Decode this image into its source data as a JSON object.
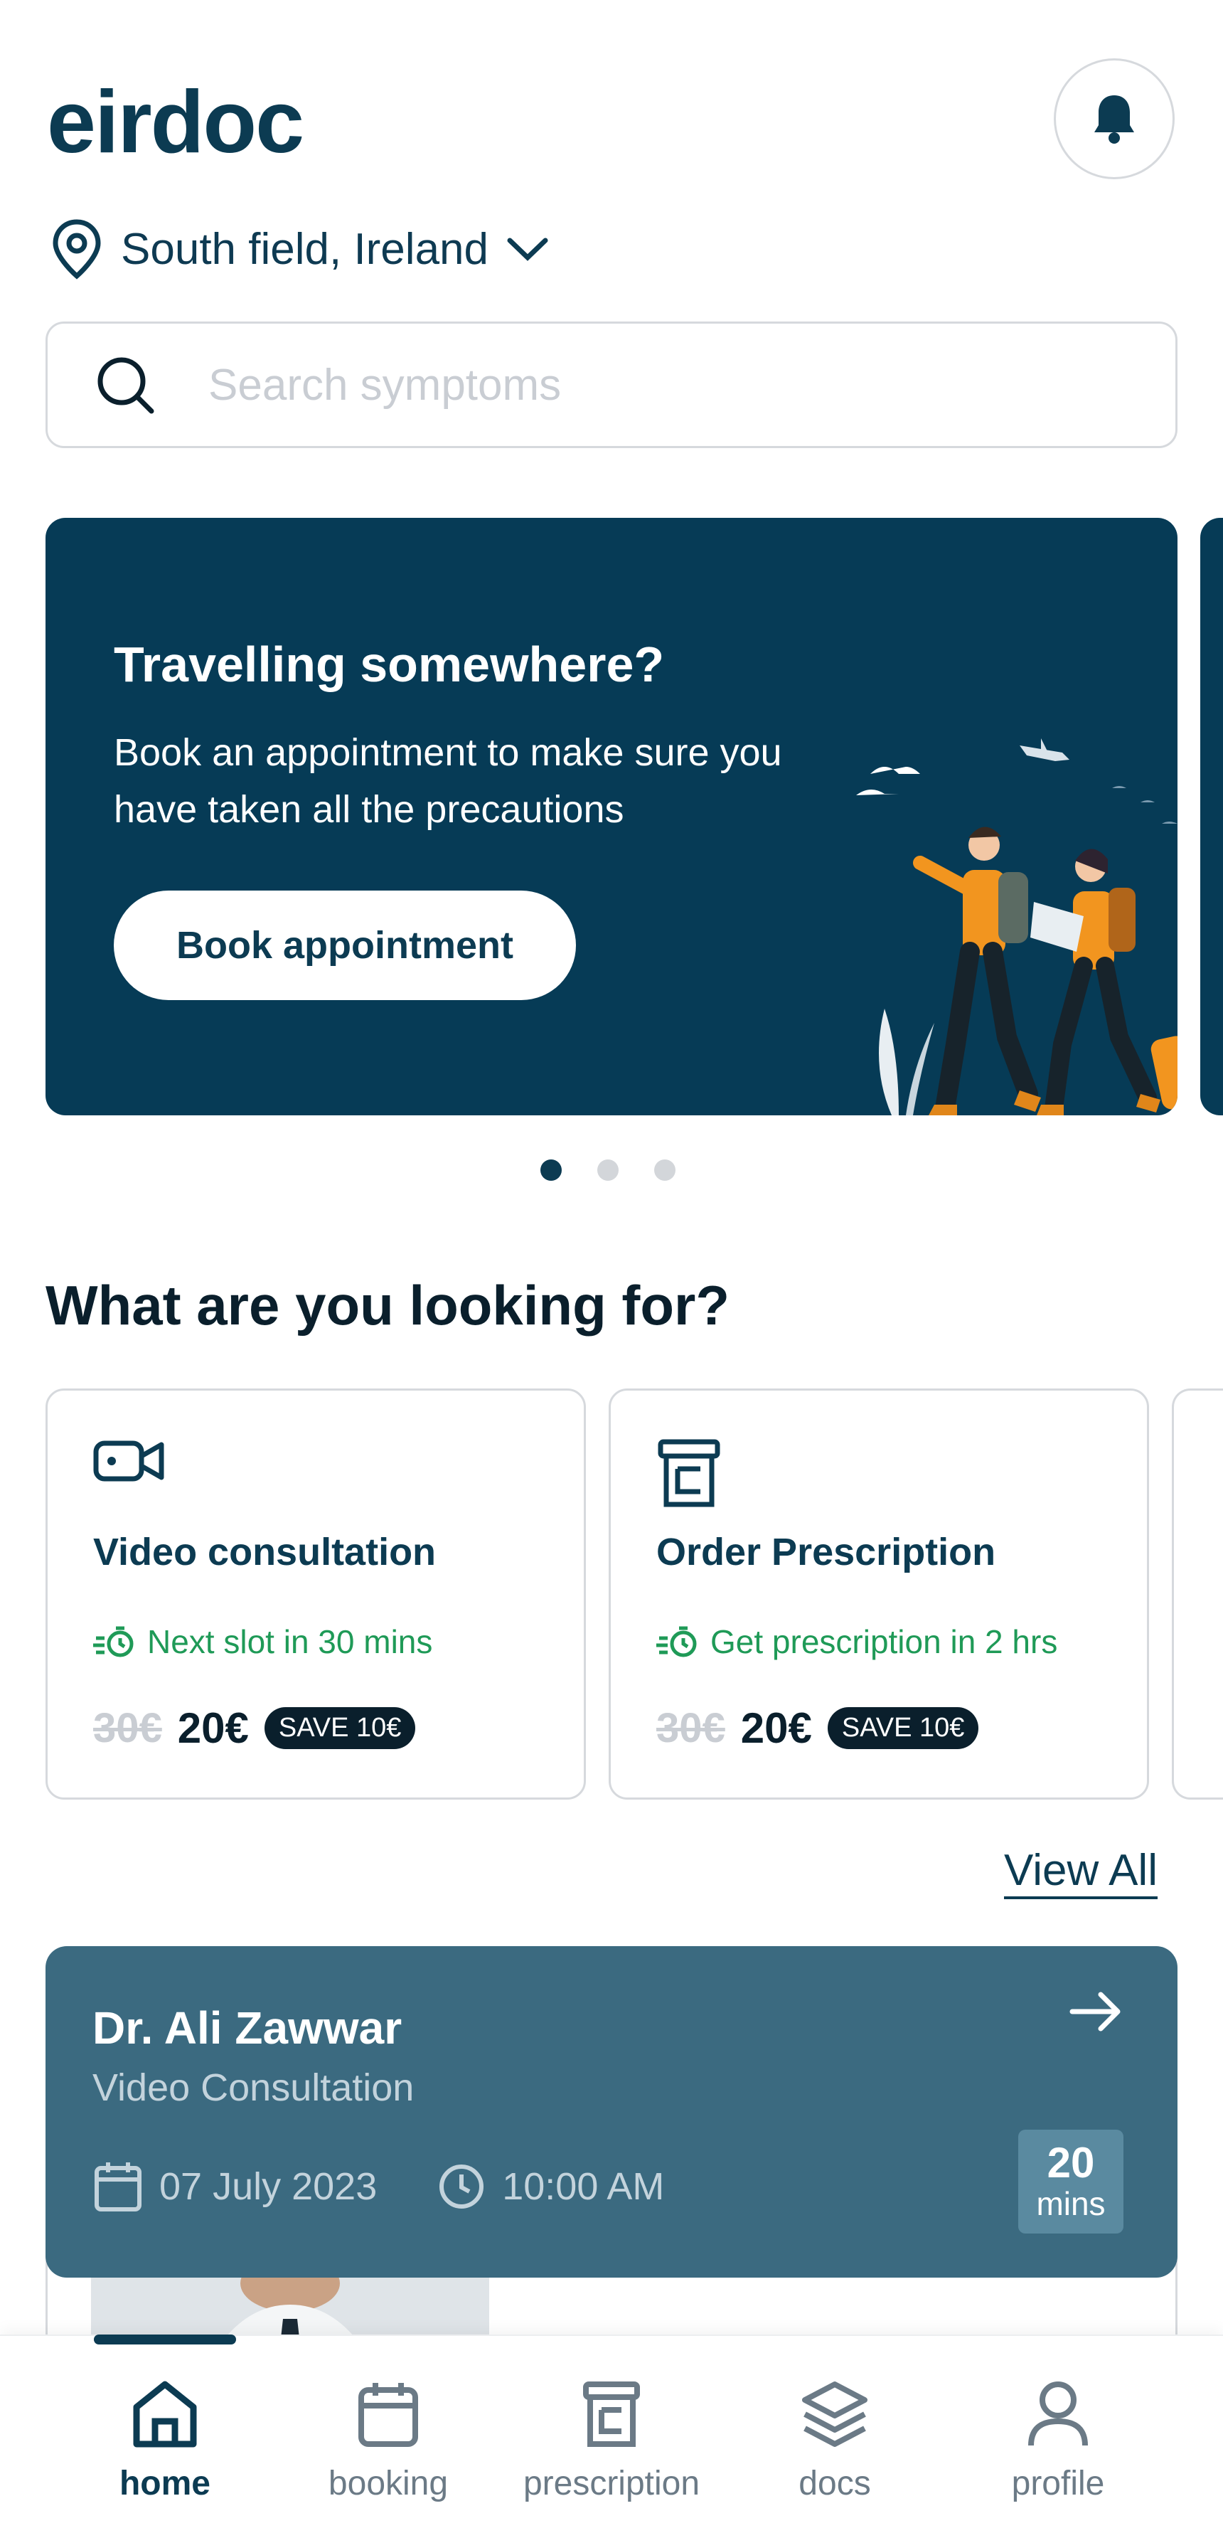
{
  "app": {
    "logo": "eirdoc"
  },
  "header": {
    "location": "South field, Ireland"
  },
  "search": {
    "placeholder": "Search symptoms"
  },
  "banner": {
    "title": "Travelling somewhere?",
    "text": "Book an appointment to make sure you have taken all the precautions",
    "button": "Book appointment",
    "dots_total": 3,
    "active_dot": 1
  },
  "section": {
    "title": "What are you looking for?"
  },
  "services": [
    {
      "title": "Video consultation",
      "slot": "Next slot in 30 mins",
      "old_price": "30€",
      "price": "20€",
      "save": "SAVE 10€",
      "icon": "video-icon"
    },
    {
      "title": "Order Prescription",
      "slot": "Get prescription in 2 hrs",
      "old_price": "30€",
      "price": "20€",
      "save": "SAVE 10€",
      "icon": "prescription-icon"
    }
  ],
  "view_all": "View All",
  "appointment": {
    "doctor": "Dr. Ali Zawwar",
    "type": "Video Consultation",
    "date": "07 July 2023",
    "time": "10:00 AM",
    "duration_value": "20",
    "duration_unit": "mins"
  },
  "nav": {
    "items": [
      {
        "label": "home",
        "icon": "home-icon",
        "active": true
      },
      {
        "label": "booking",
        "icon": "calendar-icon",
        "active": false
      },
      {
        "label": "prescription",
        "icon": "prescription-icon",
        "active": false
      },
      {
        "label": "docs",
        "icon": "layers-icon",
        "active": false
      },
      {
        "label": "profile",
        "icon": "user-icon",
        "active": false
      }
    ]
  },
  "colors": {
    "primary": "#0c3b52",
    "banner": "#063b56",
    "card": "#3b6a80",
    "green": "#1f9a57"
  }
}
